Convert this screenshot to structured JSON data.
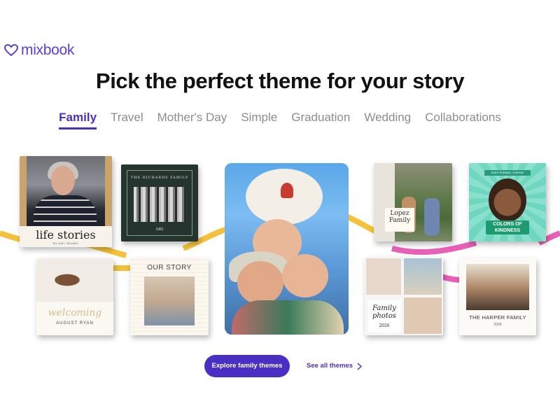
{
  "brand": {
    "name": "mixbook",
    "color": "#5b3fd1"
  },
  "headline": "Pick the perfect theme for your story",
  "tabs": [
    {
      "label": "Family",
      "active": true
    },
    {
      "label": "Travel"
    },
    {
      "label": "Mother's Day"
    },
    {
      "label": "Simple"
    },
    {
      "label": "Graduation"
    },
    {
      "label": "Wedding"
    },
    {
      "label": "Collaborations"
    }
  ],
  "books": {
    "life_stories": {
      "title": "life stories",
      "subtitle": "BY AIKI OKAMO"
    },
    "richards": {
      "title": "THE RICHARDS FAMILY",
      "year": "1981"
    },
    "lopez": {
      "title": "Lopez Family"
    },
    "kindness": {
      "tag": "KEEP SHINING, SOPHIE!",
      "title": "COLORS OF KINDNESS"
    },
    "welcoming": {
      "script": "welcoming",
      "name": "AUGUST RYAN"
    },
    "our_story": {
      "title": "OUR STORY"
    },
    "family_photos": {
      "title": "Family photos",
      "year": "2026"
    },
    "harper": {
      "title": "THE HARPER FAMILY",
      "year": "2026"
    }
  },
  "cta": {
    "primary": "Explore family themes",
    "secondary": "See all themes"
  },
  "colors": {
    "accent": "#4a2fc4",
    "ribbon_yellow": "#f5c13a",
    "ribbon_pink": "#e85fb8"
  }
}
